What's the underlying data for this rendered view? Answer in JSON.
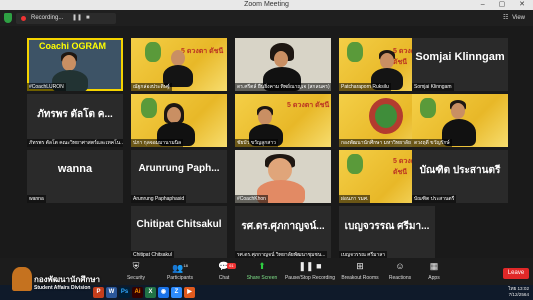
{
  "window": {
    "title": "Zoom Meeting",
    "controls": "– ▢ ✕"
  },
  "meeting_bar": {
    "recording_label": "Recording...",
    "pause_glyph": "❚❚",
    "stop_glyph": "■",
    "view_label": "View",
    "view_glyph": "☷"
  },
  "tiles": [
    {
      "name": "#CoachLURON",
      "big": ""
    },
    {
      "name": "ณัฐกล่องประดิษฐ์",
      "big": ""
    },
    {
      "name": "ดร.ศรีตล์ ยืนยิ่งคาม ทิพย์ณาญเจ (สกลนคร)",
      "big": ""
    },
    {
      "name": "Patcharaporn Ruksilu",
      "big": ""
    },
    {
      "name": "Somjai Klinngam",
      "big": "Somjai Klinngam"
    },
    {
      "name": "ภัทรพร ตัลโต คณะวิทยาศาสตร์และเทคโน...",
      "big": "ภัทรพร ตัลโต ค..."
    },
    {
      "name": "ปภา กุลจอมมานามนิล",
      "big": ""
    },
    {
      "name": "ชัยบัว ขวัญลูกสาว",
      "big": ""
    },
    {
      "name": "กองพัฒนานักศึกษา มหาวิทยาลัย",
      "big": ""
    },
    {
      "name": "ดวงฤดี ขวัญรักษ์",
      "big": ""
    },
    {
      "name": "wanna",
      "big": "wanna"
    },
    {
      "name": "Arunrung Paphaphasid",
      "big": "Arunrung Paph..."
    },
    {
      "name": "#CoachKhon",
      "big": ""
    },
    {
      "name": "ผ่อนภา รมศ.",
      "big": ""
    },
    {
      "name": "บัณฑิต ประสานตรี",
      "big": "บัณฑิต ประสานตรี"
    },
    {
      "name": "Chitipat Chitsakul",
      "big": "Chitipat Chitsakul"
    },
    {
      "name": "รศ.ดร.ศุภกาญจน์ วิทยาลัยพัฒนาชุมชน...",
      "big": "รศ.ดร.ศุภกาญจน์..."
    },
    {
      "name": "เบญจวรรณ ศรีมาลา",
      "big": "เบญจวรรณ ศรีมา..."
    }
  ],
  "deco": {
    "coach_text": "Coachi OGRAM",
    "event_text": "5 ดวงตา ดัชนี"
  },
  "toolbar": {
    "security": "Security",
    "participants": "Participants",
    "participants_count": "18",
    "chat": "Chat",
    "chat_badge": "61",
    "share_screen": "Share Screen",
    "record": "Pause/Stop Recording",
    "breakout": "Breakout Rooms",
    "reactions": "Reactions",
    "apps": "Apps",
    "leave": "Leave"
  },
  "logo": {
    "line1": "กองพัฒนานักศึกษา",
    "line2": "Student Affairs Division"
  },
  "taskbar": {
    "items": [
      "P",
      "W",
      "Ps",
      "Ai",
      "X",
      "◉",
      "Z",
      "▶"
    ],
    "time": "13:02",
    "date": "7/12/2564",
    "lang": "ไทย"
  }
}
